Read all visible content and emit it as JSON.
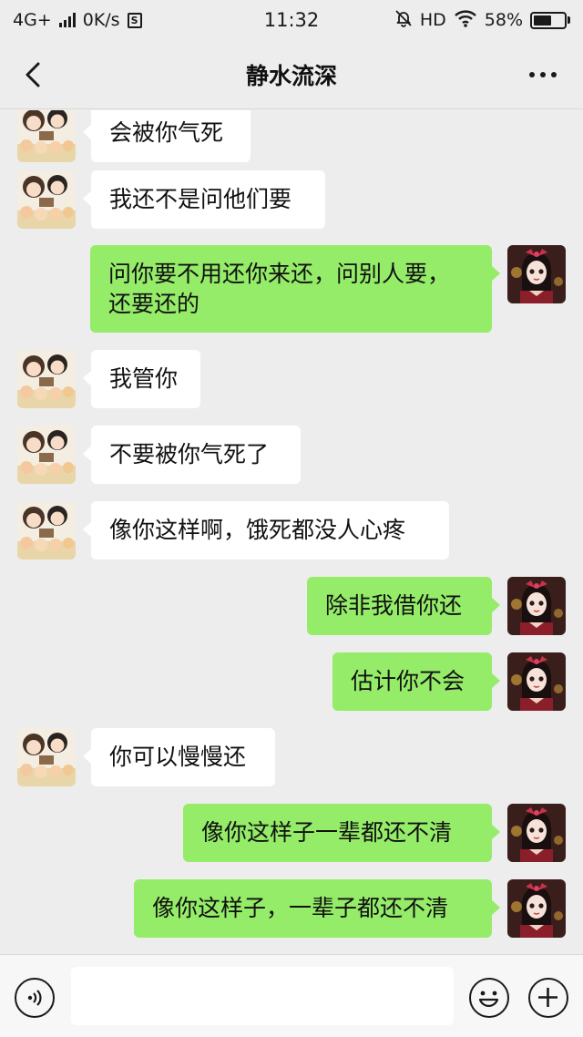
{
  "status_bar": {
    "network": "4G+",
    "speed": "0K/s",
    "time": "11:32",
    "hd": "HD",
    "battery_text": "58%",
    "battery_level": 0.58
  },
  "header": {
    "title": "静水流深"
  },
  "messages": [
    {
      "side": "in",
      "text": "会被你气死"
    },
    {
      "side": "in",
      "text": "我还不是问他们要"
    },
    {
      "side": "out",
      "text": "问你要不用还你来还，问别人要，\n还要还的"
    },
    {
      "side": "in",
      "text": "我管你"
    },
    {
      "side": "in",
      "text": "不要被你气死了"
    },
    {
      "side": "in",
      "text": "像你这样啊，饿死都没人心疼"
    },
    {
      "side": "out",
      "text": "除非我借你还"
    },
    {
      "side": "out",
      "text": "估计你不会"
    },
    {
      "side": "in",
      "text": "你可以慢慢还"
    },
    {
      "side": "out",
      "text": "像你这样子一辈都还不清"
    },
    {
      "side": "out",
      "text": "像你这样子，一辈子都还不清"
    }
  ],
  "input": {
    "placeholder": "",
    "value": ""
  },
  "colors": {
    "background": "#ededed",
    "bubble_in": "#ffffff",
    "bubble_out": "#95ec69"
  },
  "icons": {
    "back": "chevron-left-icon",
    "more": "more-dots-icon",
    "voice": "voice-icon",
    "emoji": "emoji-icon",
    "plus": "plus-icon"
  }
}
